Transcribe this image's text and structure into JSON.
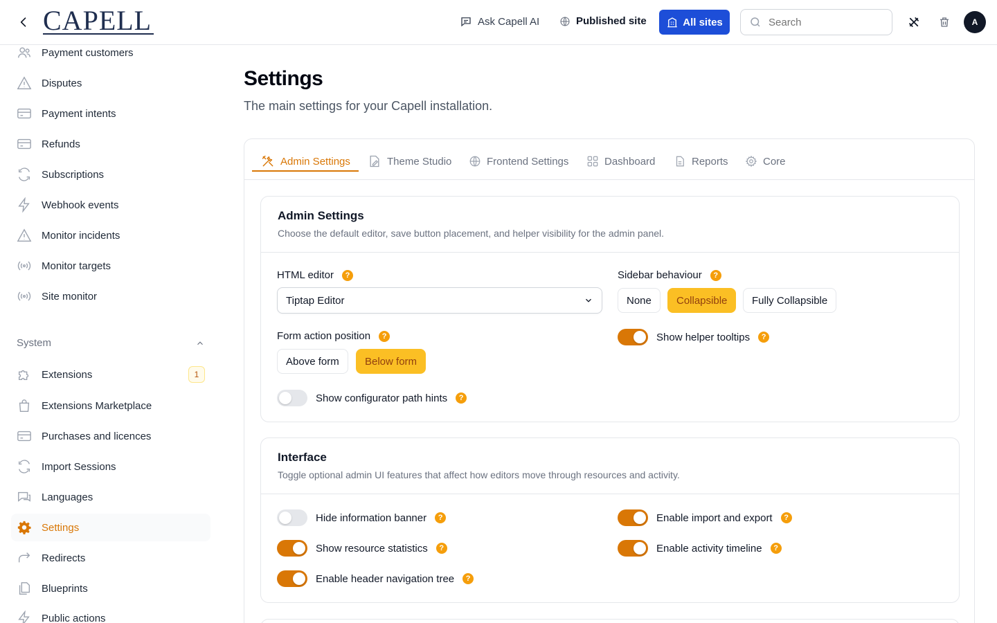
{
  "topbar": {
    "logo_text": "CAPELL",
    "ask_ai_label": "Ask Capell AI",
    "published_label": "Published site",
    "all_sites_label": "All sites",
    "search_placeholder": "Search",
    "avatar_initial": "A"
  },
  "sidebar": {
    "items_top": [
      {
        "label": "Payment customers",
        "icon": "users-icon"
      },
      {
        "label": "Disputes",
        "icon": "warning-icon"
      },
      {
        "label": "Payment intents",
        "icon": "credit-card-icon"
      },
      {
        "label": "Refunds",
        "icon": "credit-card-icon"
      },
      {
        "label": "Subscriptions",
        "icon": "refresh-icon"
      },
      {
        "label": "Webhook events",
        "icon": "bolt-icon"
      },
      {
        "label": "Monitor incidents",
        "icon": "warning-icon"
      },
      {
        "label": "Monitor targets",
        "icon": "signal-icon"
      },
      {
        "label": "Site monitor",
        "icon": "signal-icon"
      }
    ],
    "group_label": "System",
    "items_system": [
      {
        "label": "Extensions",
        "icon": "puzzle-icon",
        "badge": "1"
      },
      {
        "label": "Extensions Marketplace",
        "icon": "shopping-bag-icon"
      },
      {
        "label": "Purchases and licences",
        "icon": "credit-card-icon"
      },
      {
        "label": "Import Sessions",
        "icon": "refresh-icon"
      },
      {
        "label": "Languages",
        "icon": "chat-icon"
      },
      {
        "label": "Settings",
        "icon": "gear-icon",
        "active": true
      },
      {
        "label": "Redirects",
        "icon": "redirect-icon"
      },
      {
        "label": "Blueprints",
        "icon": "documents-icon"
      },
      {
        "label": "Public actions",
        "icon": "bolt-icon"
      }
    ]
  },
  "main": {
    "title": "Settings",
    "subtitle": "The main settings for your Capell installation.",
    "tabs": [
      {
        "label": "Admin Settings",
        "icon": "tools-icon",
        "active": true
      },
      {
        "label": "Theme Studio",
        "icon": "paint-icon"
      },
      {
        "label": "Frontend Settings",
        "icon": "globe-icon"
      },
      {
        "label": "Dashboard",
        "icon": "grid-icon"
      },
      {
        "label": "Reports",
        "icon": "document-icon"
      },
      {
        "label": "Core",
        "icon": "gear-icon"
      }
    ],
    "admin_card": {
      "title": "Admin Settings",
      "description": "Choose the default editor, save button placement, and helper visibility for the admin panel.",
      "html_editor_label": "HTML editor",
      "html_editor_value": "Tiptap Editor",
      "sidebar_behaviour_label": "Sidebar behaviour",
      "sidebar_options": [
        "None",
        "Collapsible",
        "Fully Collapsible"
      ],
      "sidebar_selected": "Collapsible",
      "form_action_label": "Form action position",
      "form_action_options": [
        "Above form",
        "Below form"
      ],
      "form_action_selected": "Below form",
      "helper_tooltips_label": "Show helper tooltips",
      "helper_tooltips_on": true,
      "path_hints_label": "Show configurator path hints",
      "path_hints_on": false
    },
    "interface_card": {
      "title": "Interface",
      "description": "Toggle optional admin UI features that affect how editors move through resources and activity.",
      "toggles": [
        {
          "label": "Hide information banner",
          "on": false
        },
        {
          "label": "Enable import and export",
          "on": true
        },
        {
          "label": "Show resource statistics",
          "on": true
        },
        {
          "label": "Enable activity timeline",
          "on": true
        },
        {
          "label": "Enable header navigation tree",
          "on": true
        }
      ]
    },
    "help_glyph": "?"
  },
  "colors": {
    "accent": "#d97706",
    "segment_on": "#fbbf24",
    "primary_blue": "#1d4ed8",
    "help_badge": "#f59e0b"
  }
}
